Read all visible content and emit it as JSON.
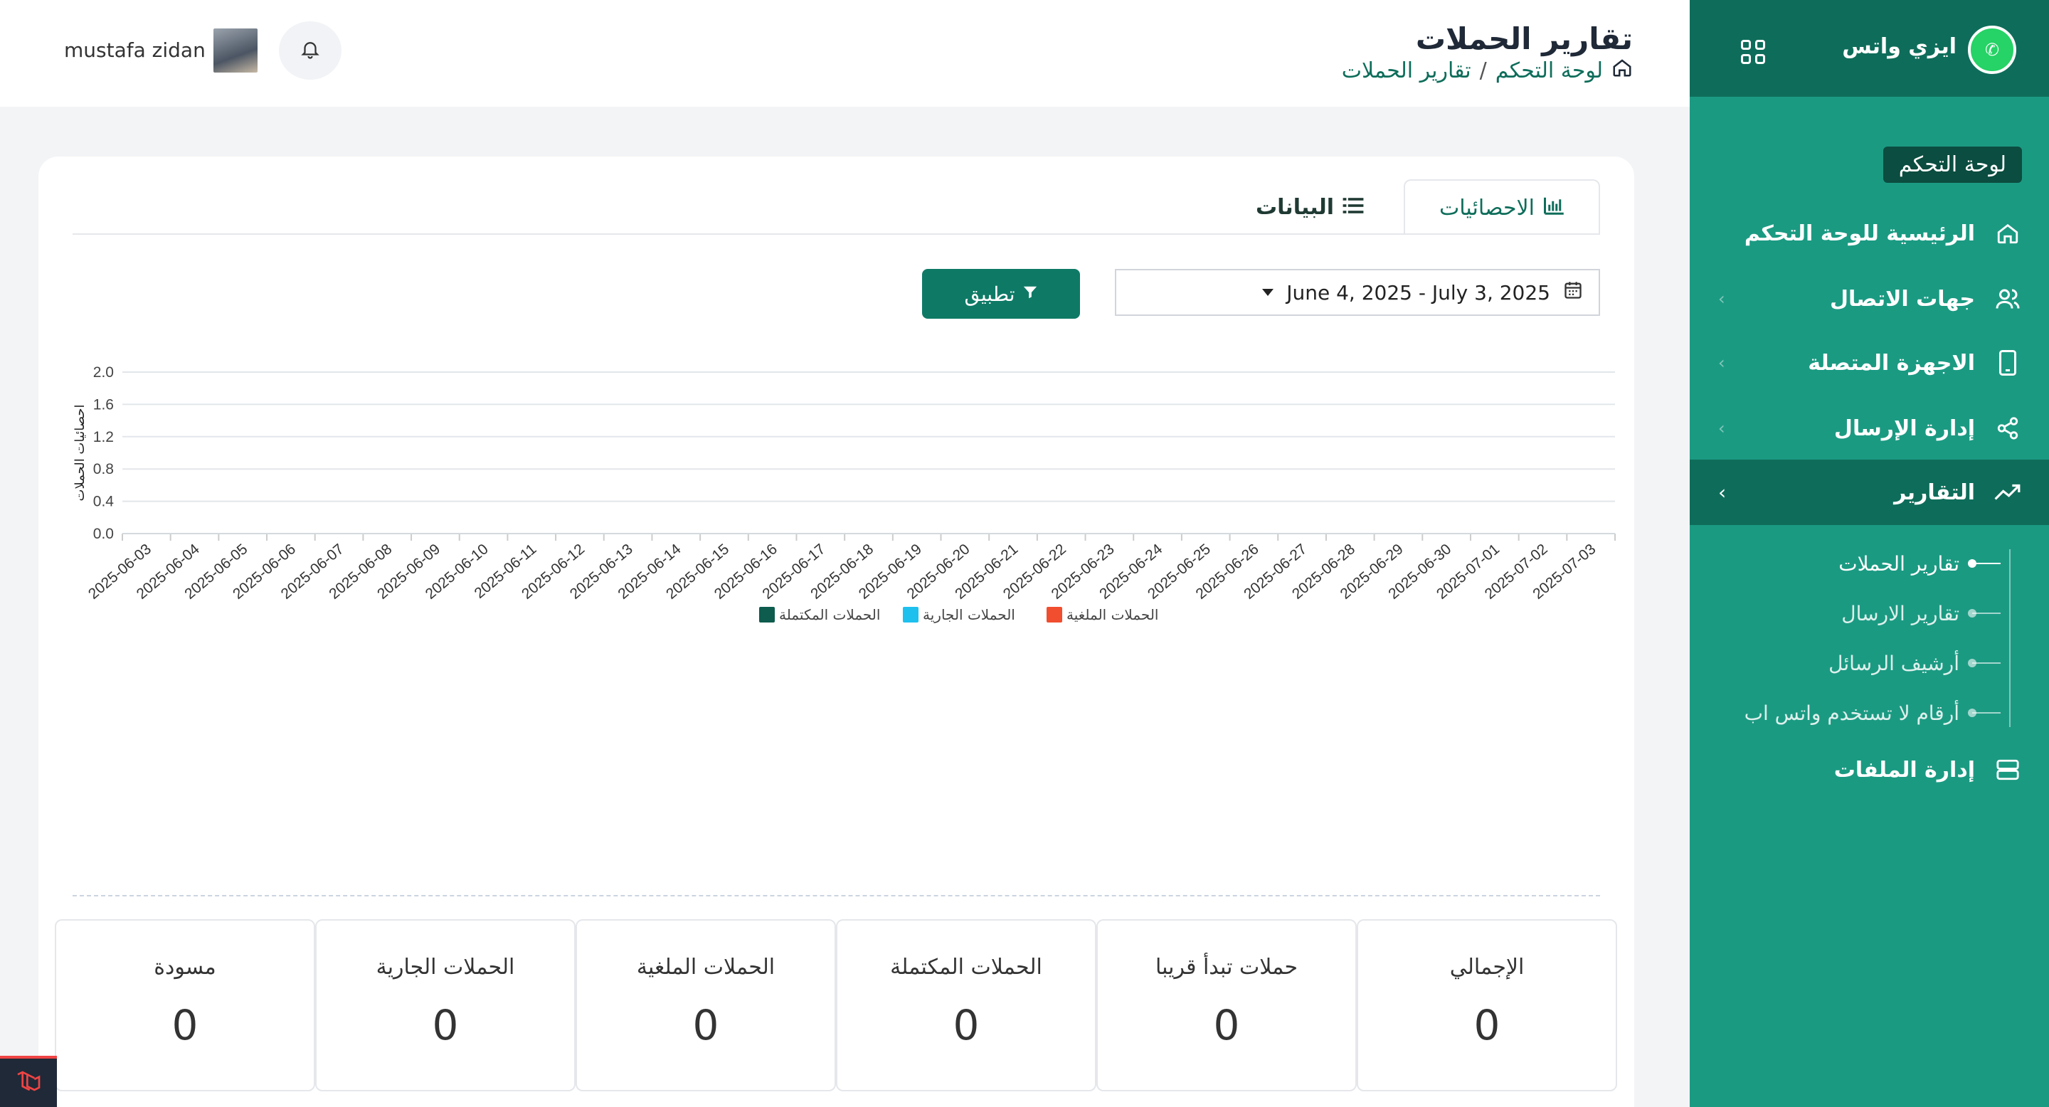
{
  "sidebar": {
    "brand": "ايزي واتس",
    "section": "لوحة التحكم",
    "items": [
      {
        "label": "الرئيسية للوحة التحكم",
        "icon": "home-icon"
      },
      {
        "label": "جهات الاتصال",
        "icon": "users-icon"
      },
      {
        "label": "الاجهزة المتصلة",
        "icon": "device-icon"
      },
      {
        "label": "إدارة الإرسال",
        "icon": "share-icon"
      },
      {
        "label": "التقارير",
        "icon": "trend-icon"
      },
      {
        "label": "إدارة الملفات",
        "icon": "storage-icon"
      }
    ],
    "sub_items": [
      {
        "label": "تقارير الحملات"
      },
      {
        "label": "تقارير الارسال"
      },
      {
        "label": "أرشيف الرسائل"
      },
      {
        "label": "أرقام لا تستخدم واتس اب"
      }
    ]
  },
  "header": {
    "title": "تقارير الحملات",
    "breadcrumb": [
      "لوحة التحكم",
      "تقارير الحملات"
    ],
    "breadcrumb_sep": "/",
    "user_name": "mustafa zidan"
  },
  "tabs": {
    "stats": "الاحصائيات",
    "data": "البيانات"
  },
  "filter": {
    "date_range": "June 4, 2025 - July 3, 2025",
    "apply_label": "تطبيق"
  },
  "chart_data": {
    "type": "bar",
    "ylabel": "احصائيات الحملات",
    "ylim": [
      0,
      2.0
    ],
    "yticks": [
      "0.0",
      "0.4",
      "0.8",
      "1.2",
      "1.6",
      "2.0"
    ],
    "categories": [
      "2025-06-03",
      "2025-06-04",
      "2025-06-05",
      "2025-06-06",
      "2025-06-07",
      "2025-06-08",
      "2025-06-09",
      "2025-06-10",
      "2025-06-11",
      "2025-06-12",
      "2025-06-13",
      "2025-06-14",
      "2025-06-15",
      "2025-06-16",
      "2025-06-17",
      "2025-06-18",
      "2025-06-19",
      "2025-06-20",
      "2025-06-21",
      "2025-06-22",
      "2025-06-23",
      "2025-06-24",
      "2025-06-25",
      "2025-06-26",
      "2025-06-27",
      "2025-06-28",
      "2025-06-29",
      "2025-06-30",
      "2025-07-01",
      "2025-07-02",
      "2025-07-03"
    ],
    "series": [
      {
        "name": "الحملات المكتملة",
        "color": "#0d5c4d",
        "values": [
          0,
          0,
          0,
          0,
          0,
          0,
          0,
          0,
          0,
          0,
          0,
          0,
          0,
          0,
          0,
          0,
          0,
          0,
          0,
          0,
          0,
          0,
          0,
          0,
          0,
          0,
          0,
          0,
          0,
          0,
          0
        ]
      },
      {
        "name": "الحملات الجارية",
        "color": "#1ec0ee",
        "values": [
          0,
          0,
          0,
          0,
          0,
          0,
          0,
          0,
          0,
          0,
          0,
          0,
          0,
          0,
          0,
          0,
          0,
          0,
          0,
          0,
          0,
          0,
          0,
          0,
          0,
          0,
          0,
          0,
          0,
          0,
          0
        ]
      },
      {
        "name": "الحملات الملغية",
        "color": "#f04e2f",
        "values": [
          0,
          0,
          0,
          0,
          0,
          0,
          0,
          0,
          0,
          0,
          0,
          0,
          0,
          0,
          0,
          0,
          0,
          0,
          0,
          0,
          0,
          0,
          0,
          0,
          0,
          0,
          0,
          0,
          0,
          0,
          0
        ]
      }
    ],
    "legend": "bottom-center",
    "grid": true
  },
  "stats": [
    {
      "label": "الإجمالي",
      "value": "0"
    },
    {
      "label": "حملات تبدأ قريبا",
      "value": "0"
    },
    {
      "label": "الحملات المكتملة",
      "value": "0"
    },
    {
      "label": "الحملات الملغية",
      "value": "0"
    },
    {
      "label": "الحملات الجارية",
      "value": "0"
    },
    {
      "label": "مسودة",
      "value": "0"
    }
  ]
}
